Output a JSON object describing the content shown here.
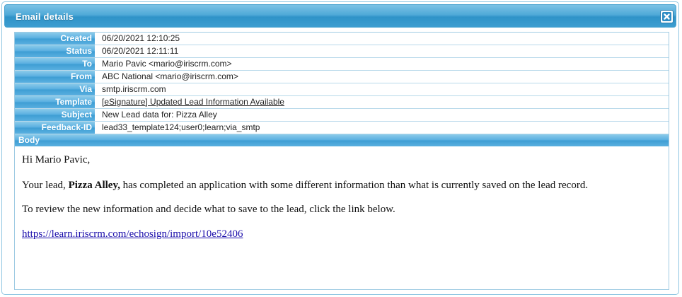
{
  "dialog": {
    "title": "Email details",
    "close_icon": "close-x-icon"
  },
  "fields": [
    {
      "label": "Created",
      "value": "06/20/2021 12:10:25"
    },
    {
      "label": "Status",
      "value": "06/20/2021 12:11:11"
    },
    {
      "label": "To",
      "value": "Mario Pavic <mario@iriscrm.com>"
    },
    {
      "label": "From",
      "value": "ABC National <mario@iriscrm.com>"
    },
    {
      "label": "Via",
      "value": "smtp.iriscrm.com"
    },
    {
      "label": "Template",
      "value": "[eSignature] Updated Lead Information Available"
    },
    {
      "label": "Subject",
      "value": "New Lead data for: Pizza Alley"
    },
    {
      "label": "Feedback-ID",
      "value": "lead33_template124;user0;learn;via_smtp"
    }
  ],
  "body": {
    "label": "Body",
    "greeting": "Hi Mario Pavic,",
    "p1_pre": "Your lead, ",
    "p1_bold": "Pizza Alley,",
    "p1_post": " has completed an application with some different information than what is currently saved on the lead record.",
    "p2": "To review the new information and decide what to save to the lead, click the link below.",
    "link": "https://learn.iriscrm.com/echosign/import/10e52406"
  },
  "colors": {
    "title_bar": "#3c9dd0",
    "label_bg": "#56ade0",
    "link": "#1a0dab"
  }
}
